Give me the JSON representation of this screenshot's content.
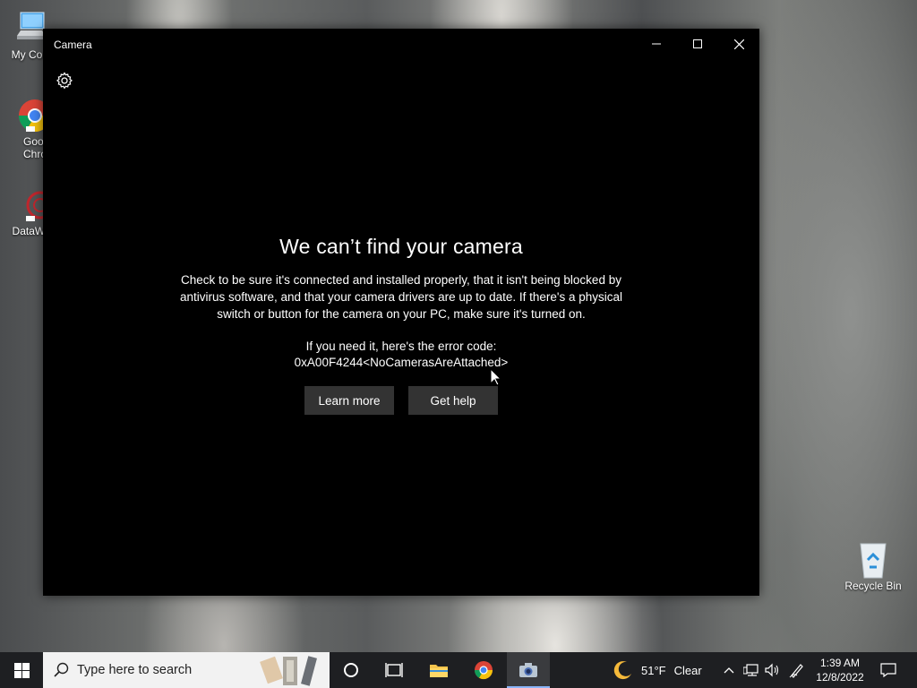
{
  "desktop": {
    "icons": [
      {
        "label": "My Com"
      },
      {
        "label": "Goog Chron"
      },
      {
        "label": "DataWa"
      },
      {
        "label": "Recycle Bin"
      }
    ]
  },
  "window": {
    "title": "Camera",
    "controls": [
      "minimize",
      "maximize",
      "close"
    ]
  },
  "error": {
    "headline": "We can’t find your camera",
    "description": "Check to be sure it's connected and installed properly, that it isn't being blocked by antivirus software, and that your camera drivers are up to date. If there's a physical switch or button for the camera on your PC, make sure it's turned on.",
    "code_label": "If you need it, here's the error code:",
    "code": "0xA00F4244<NoCamerasAreAttached>",
    "learn_more": "Learn more",
    "get_help": "Get help"
  },
  "taskbar": {
    "search_placeholder": "Type here to search",
    "pinned": [
      "task-view",
      "file-explorer",
      "chrome",
      "camera"
    ],
    "weather_temp": "51°F",
    "weather_cond": "Clear",
    "time": "1:39 AM",
    "date": "12/8/2022"
  },
  "colors": {
    "window_bg": "#000000",
    "button_bg": "#333333",
    "taskbar_bg": "#1e1f22",
    "accent": "#8ab4f8"
  }
}
